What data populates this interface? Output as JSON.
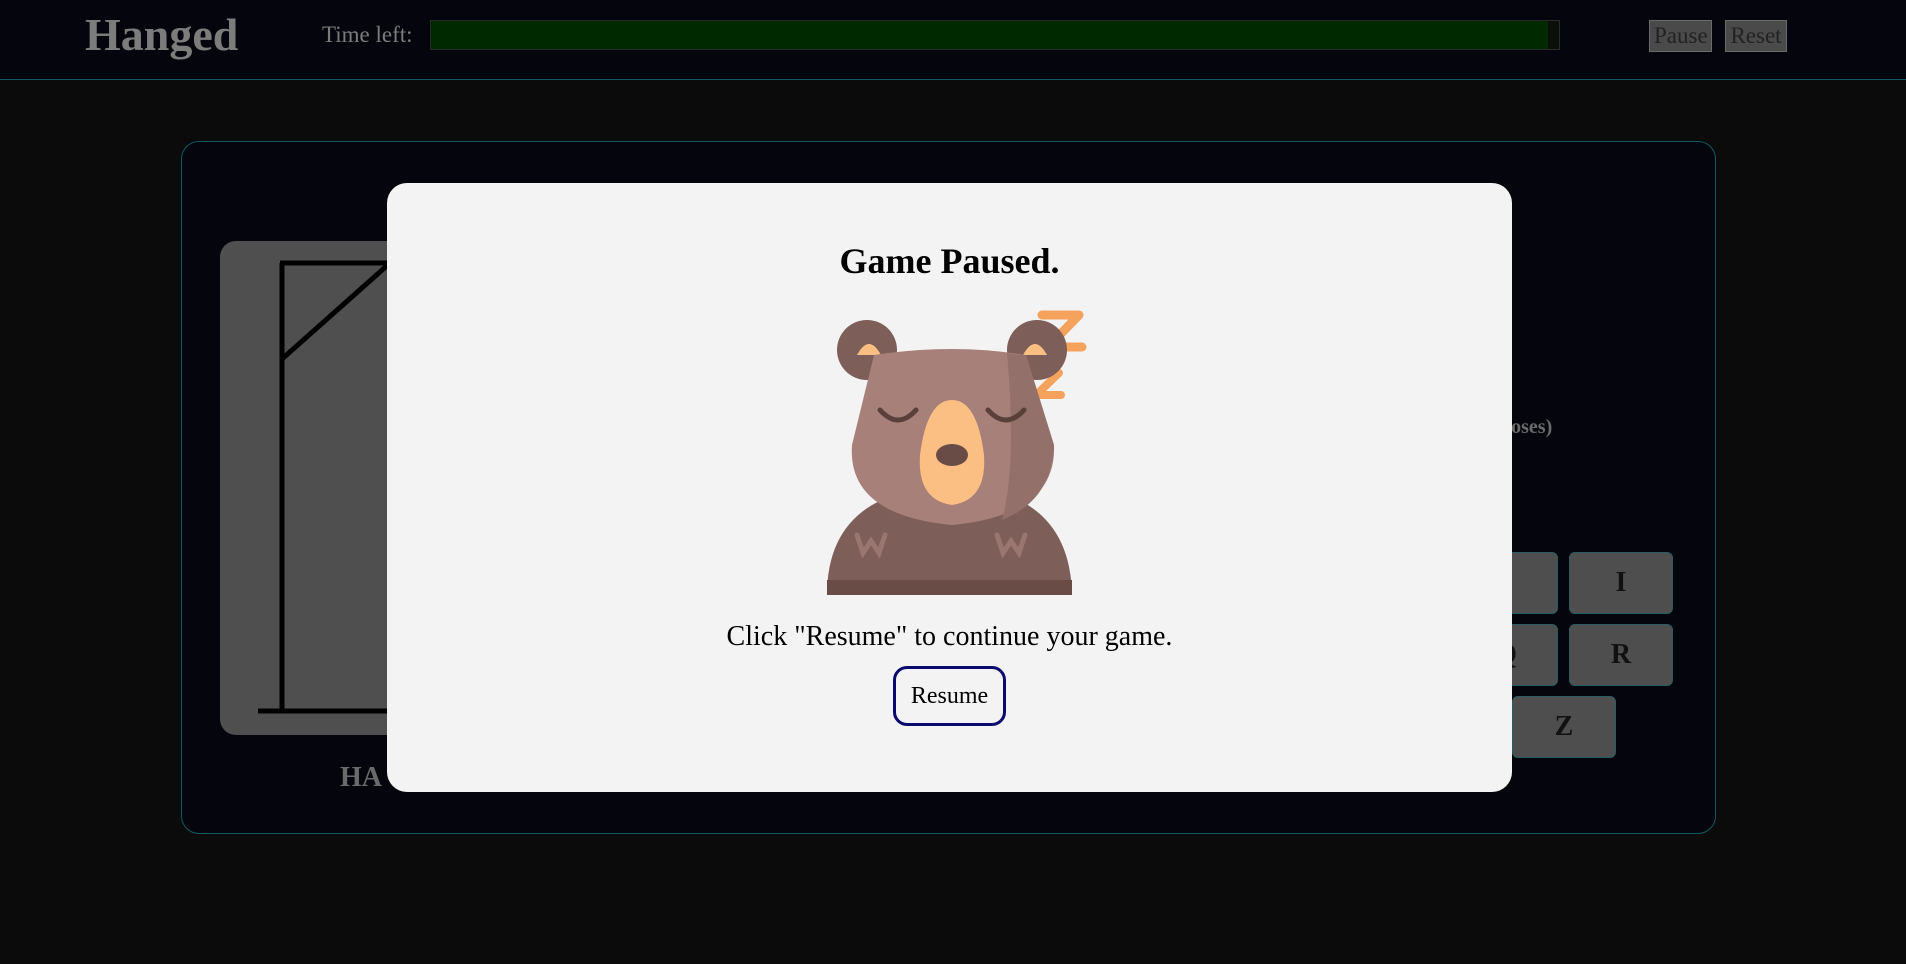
{
  "header": {
    "title": "Hanged",
    "time_label": "Time left:",
    "time_remaining_fraction": 0.99,
    "pause_label": "Pause",
    "reset_label": "Reset"
  },
  "game": {
    "hangman_label": "HA",
    "guess_hint_fragment": "poses)",
    "keys": [
      "I",
      "I",
      "Q",
      "R",
      "Z"
    ]
  },
  "modal": {
    "title": "Game Paused.",
    "message": "Click \"Resume\" to continue your game.",
    "resume_label": "Resume",
    "illustration": "sleeping-bear"
  },
  "colors": {
    "background": "#0b0b0b",
    "header_bg": "#05060d",
    "accent_border": "#0f5a63",
    "timebar_fill": "#002900",
    "modal_bg": "#f3f3f3",
    "resume_border": "#0a0a6e"
  }
}
